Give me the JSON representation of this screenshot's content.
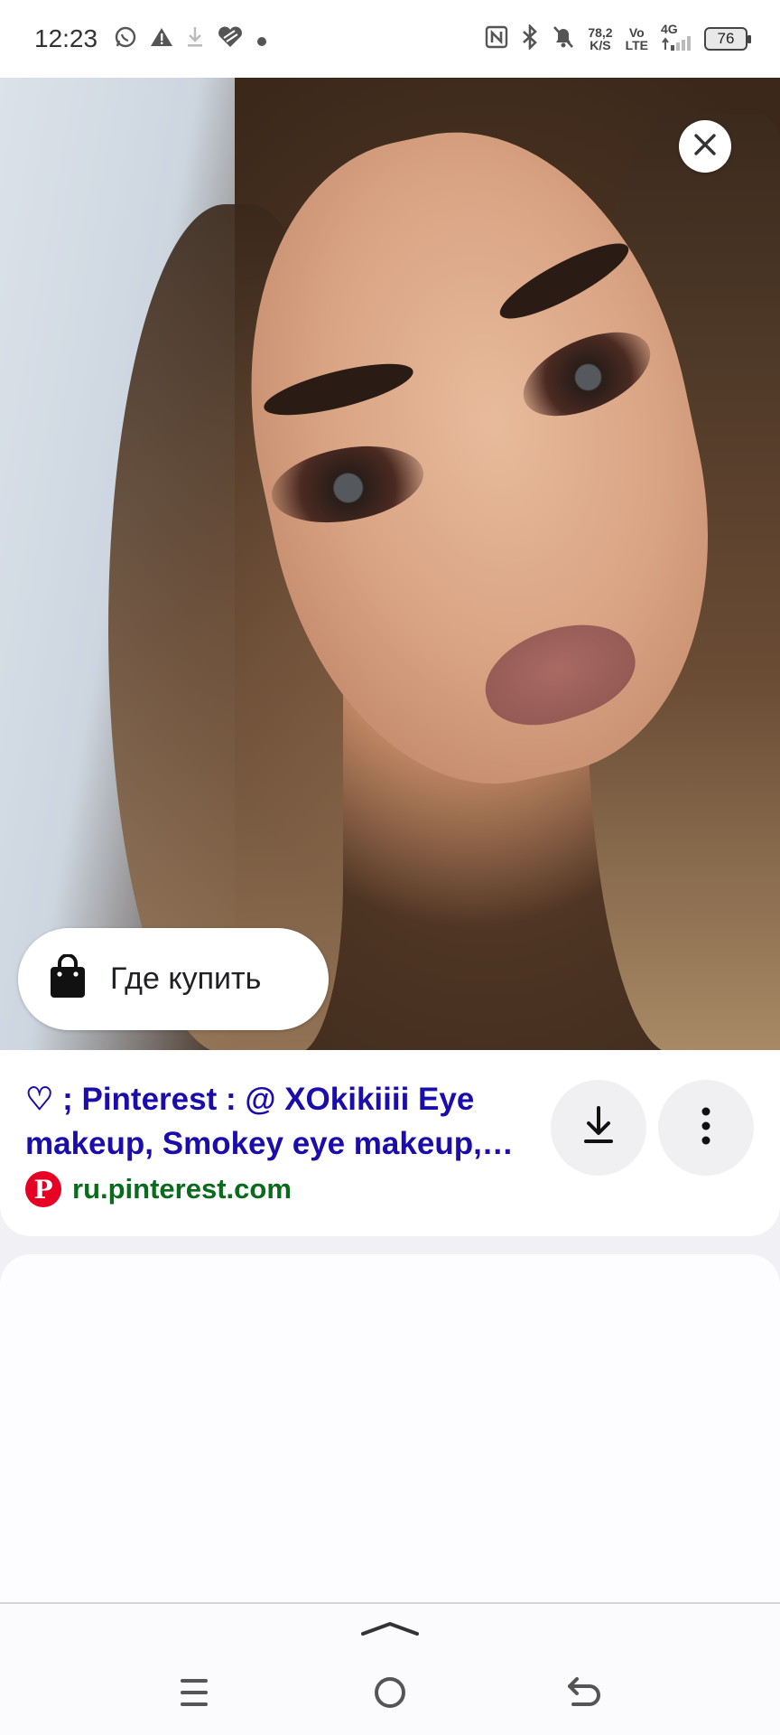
{
  "status_bar": {
    "time": "12:23",
    "left_icons": [
      "whatsapp-icon",
      "warning-icon",
      "download-icon",
      "heart-icon",
      "dot-icon"
    ],
    "net_speed_value": "78,2",
    "net_speed_unit": "K/S",
    "volte_top": "Vo",
    "volte_bottom": "LTE",
    "network_type": "4G",
    "battery_level": "76",
    "right_icons": [
      "nfc-icon",
      "bluetooth-icon",
      "mute-icon",
      "signal-icon",
      "battery-icon"
    ]
  },
  "image_viewer": {
    "close_icon": "close-icon",
    "shop_button": {
      "icon": "shopping-bag-icon",
      "label": "Где купить"
    }
  },
  "result": {
    "title": "♡ ; Pinterest : @ XOkikiiii Eye makeup, Smokey eye makeup,…",
    "source_icon": "pinterest-icon",
    "source_logo_letter": "P",
    "source_domain": "ru.pinterest.com",
    "download_icon": "download-icon",
    "more_icon": "more-vertical-icon"
  },
  "bottom_nav": {
    "handle_icon": "chevron-up-icon",
    "menu_icon": "menu-icon",
    "home_icon": "home-circle-icon",
    "back_icon": "back-icon"
  },
  "colors": {
    "title_link": "#1a0dab",
    "source_domain": "#0b6b1d",
    "pinterest_red": "#e60023",
    "button_bg": "#f0eff2"
  }
}
